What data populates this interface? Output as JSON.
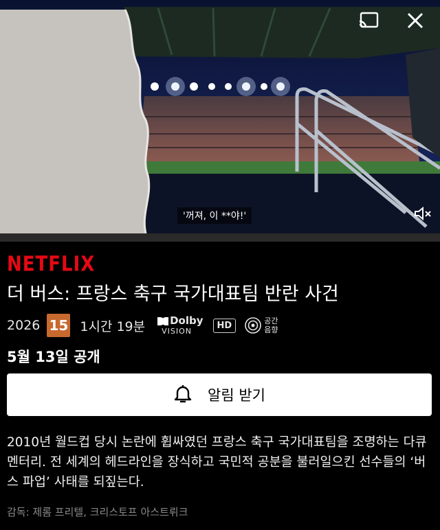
{
  "player": {
    "subtitle": "'꺼져, 이 **야!'",
    "progress_fraction": 1.0,
    "icons": {
      "cast": "cast-icon",
      "close": "close-icon",
      "mute": "mute-icon"
    }
  },
  "brand": {
    "name": "NETFLIX",
    "color": "#e50914"
  },
  "title": "더 버스: 프랑스 축구 국가대표팀 반란 사건",
  "meta": {
    "year": "2026",
    "rating": "15",
    "runtime": "1시간 19분",
    "dolby_top": "Dolby",
    "dolby_bottom": "VISION",
    "hd": "HD",
    "spatial_line1": "공간",
    "spatial_line2": "음향"
  },
  "release": "5월 13일 공개",
  "notify_button": {
    "label": "알림 받기",
    "icon": "bell-icon"
  },
  "description": "2010년 월드컵 당시 논란에 휩싸였던 프랑스 축구 국가대표팀을 조명하는 다큐멘터리. 전 세계의 헤드라인을 장식하고 국민적 공분을 불러일으킨 선수들의 ‘버스 파업’ 사태를 되짚는다.",
  "director": "감독: 제롬 프리텔, 크리스토프 아스트뤼크"
}
